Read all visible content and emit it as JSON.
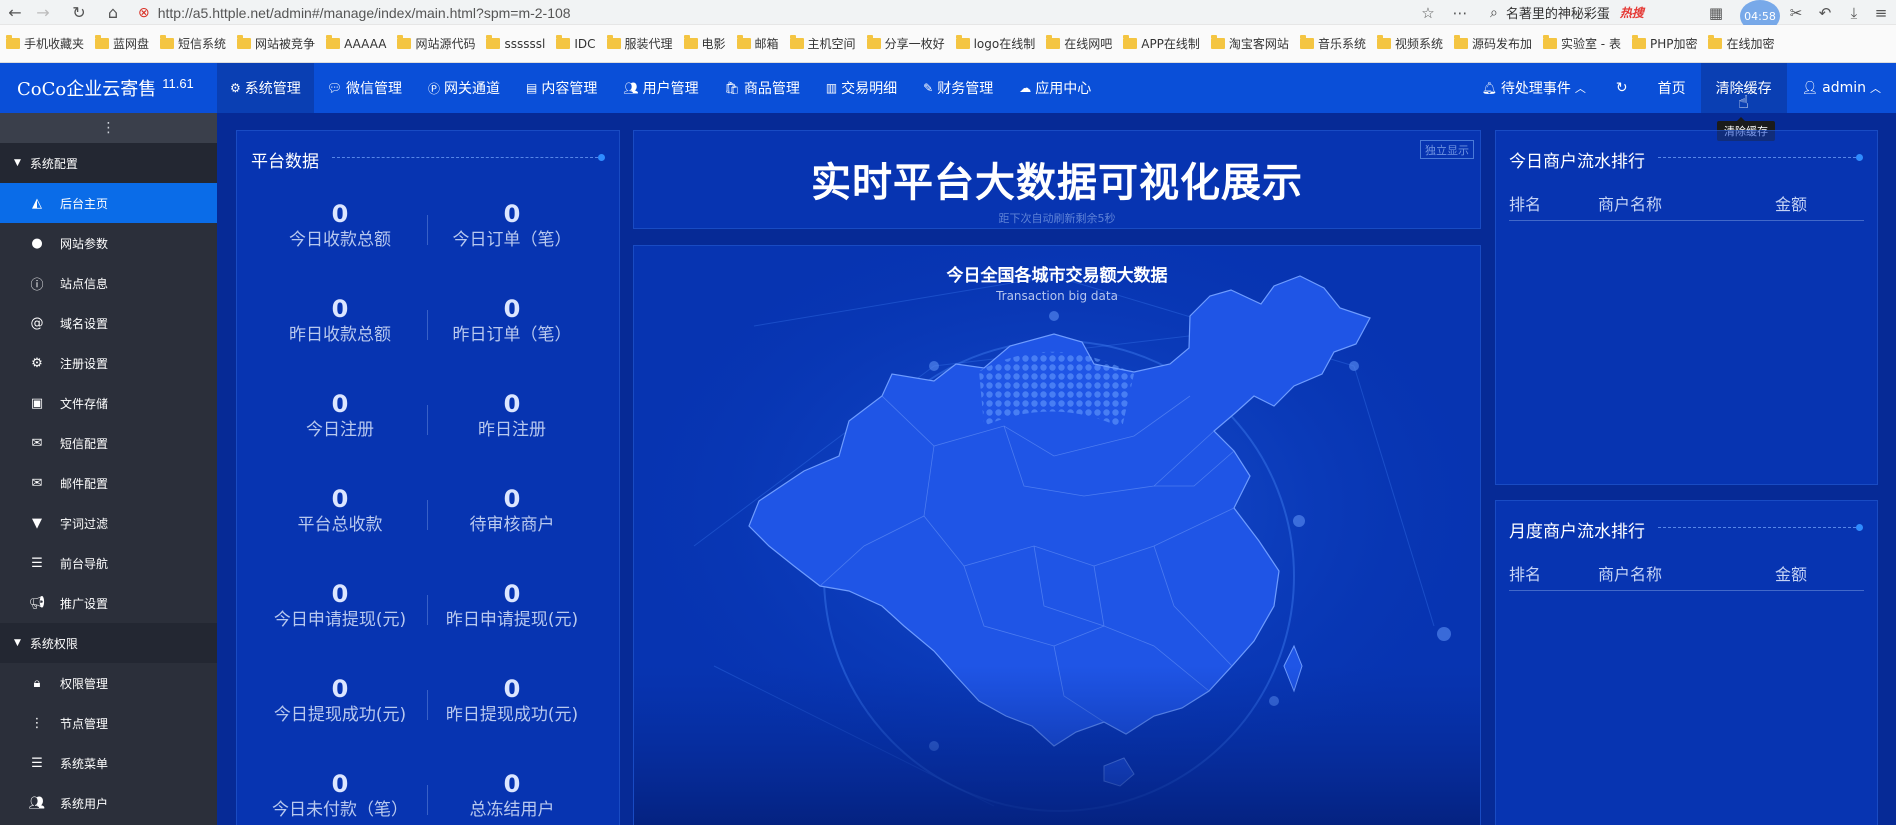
{
  "browser": {
    "url": "http://a5.httple.net/admin#/manage/index/main.html?spm=m-2-108",
    "search_text": "名著里的神秘彩蛋",
    "search_hot": "热搜",
    "bubble_text": "04:58",
    "bookmarks": [
      "手机收藏夹",
      "蓝网盘",
      "短信系统",
      "网站被竞争",
      "AAAAA",
      "网站源代码",
      "ssssssl",
      "IDC",
      "服装代理",
      "电影",
      "邮箱",
      "主机空间",
      "分享一枚好",
      "logo在线制",
      "在线网吧",
      "APP在线制",
      "淘宝客网站",
      "音乐系统",
      "视频系统",
      "源码发布加",
      "实验室 - 表",
      "PHP加密",
      "在线加密"
    ]
  },
  "header": {
    "logo": "CoCo企业云寄售",
    "version": "11.61",
    "nav": [
      {
        "label": "系统管理",
        "icon": "gear-icon"
      },
      {
        "label": "微信管理",
        "icon": "wechat-icon"
      },
      {
        "label": "网关通道",
        "icon": "gateway-icon"
      },
      {
        "label": "内容管理",
        "icon": "document-icon"
      },
      {
        "label": "用户管理",
        "icon": "users-icon"
      },
      {
        "label": "商品管理",
        "icon": "bag-icon"
      },
      {
        "label": "交易明细",
        "icon": "chart-icon"
      },
      {
        "label": "财务管理",
        "icon": "finance-icon"
      },
      {
        "label": "应用中心",
        "icon": "cloud-icon"
      }
    ],
    "pending": "待处理事件",
    "home": "首页",
    "clear_cache": "清除缓存",
    "user": "admin",
    "tooltip": "清除缓存"
  },
  "sidebar": {
    "groups": [
      {
        "label": "系统配置",
        "items": [
          {
            "label": "后台主页",
            "icon": "chart-area-icon",
            "active": true
          },
          {
            "label": "网站参数",
            "icon": "apple-icon"
          },
          {
            "label": "站点信息",
            "icon": "info-icon"
          },
          {
            "label": "域名设置",
            "icon": "at-icon"
          },
          {
            "label": "注册设置",
            "icon": "gear-icon"
          },
          {
            "label": "文件存储",
            "icon": "save-icon"
          },
          {
            "label": "短信配置",
            "icon": "envelope-icon"
          },
          {
            "label": "邮件配置",
            "icon": "envelope-icon"
          },
          {
            "label": "字词过滤",
            "icon": "filter-icon"
          },
          {
            "label": "前台导航",
            "icon": "list-icon"
          },
          {
            "label": "推广设置",
            "icon": "megaphone-icon"
          }
        ]
      },
      {
        "label": "系统权限",
        "items": [
          {
            "label": "权限管理",
            "icon": "lock-icon"
          },
          {
            "label": "节点管理",
            "icon": "vertical-dots-icon"
          },
          {
            "label": "系统菜单",
            "icon": "list-icon"
          },
          {
            "label": "系统用户",
            "icon": "users-icon"
          }
        ]
      }
    ]
  },
  "platform": {
    "title": "平台数据",
    "stats": [
      {
        "value": "0",
        "label": "今日收款总额"
      },
      {
        "value": "0",
        "label": "今日订单（笔）"
      },
      {
        "value": "0",
        "label": "昨日收款总额"
      },
      {
        "value": "0",
        "label": "昨日订单（笔）"
      },
      {
        "value": "0",
        "label": "今日注册"
      },
      {
        "value": "0",
        "label": "昨日注册"
      },
      {
        "value": "0",
        "label": "平台总收款"
      },
      {
        "value": "0",
        "label": "待审核商户"
      },
      {
        "value": "0",
        "label": "今日申请提现(元)"
      },
      {
        "value": "0",
        "label": "昨日申请提现(元)"
      },
      {
        "value": "0",
        "label": "今日提现成功(元)"
      },
      {
        "value": "0",
        "label": "昨日提现成功(元)"
      },
      {
        "value": "0",
        "label": "今日未付款（笔）"
      },
      {
        "value": "0",
        "label": "总冻结用户"
      }
    ]
  },
  "center": {
    "title": "实时平台大数据可视化展示",
    "refresh": "距下次自动刷新剩余5秒",
    "independent": "独立显示",
    "map_title": "今日全国各城市交易额大数据",
    "map_sub": "Transaction big data"
  },
  "today_rank": {
    "title": "今日商户流水排行",
    "cols": [
      "排名",
      "商户名称",
      "金额"
    ]
  },
  "month_rank": {
    "title": "月度商户流水排行",
    "cols": [
      "排名",
      "商户名称",
      "金额"
    ]
  }
}
